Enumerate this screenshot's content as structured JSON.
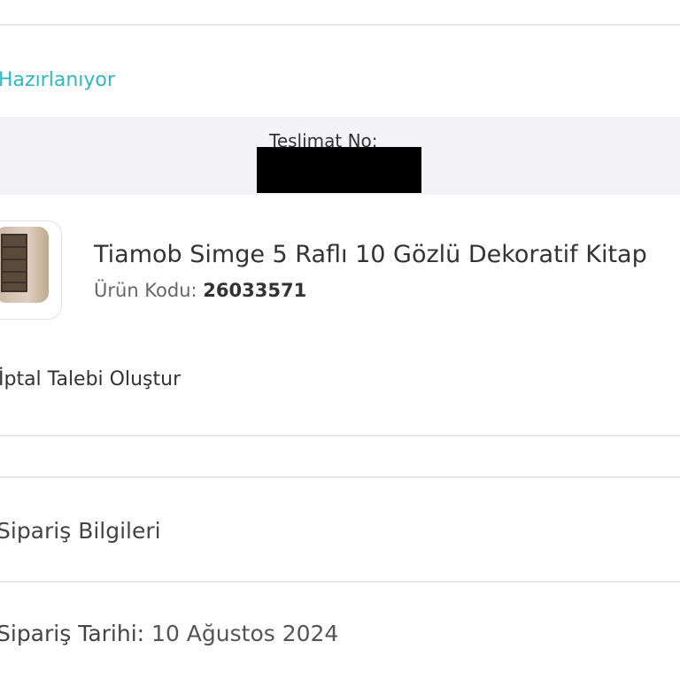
{
  "order": {
    "status": "Hazırlanıyor",
    "delivery_label": "Teslimat No:",
    "product": {
      "name": "Tiamob Simge 5 Raflı 10 Gözlü Dekoratif Kitap",
      "code_label": "Ürün Kodu:",
      "code": "26033571"
    },
    "cancel_label": "İptal Talebi Oluştur"
  },
  "order_info": {
    "title": "Sipariş Bilgileri",
    "date_label": "Sipariş Tarihi:",
    "date_value": "10 Ağustos 2024"
  },
  "colors": {
    "status": "#2eb8c4",
    "band": "#f4f4f6",
    "divider": "#e6e6e6"
  }
}
